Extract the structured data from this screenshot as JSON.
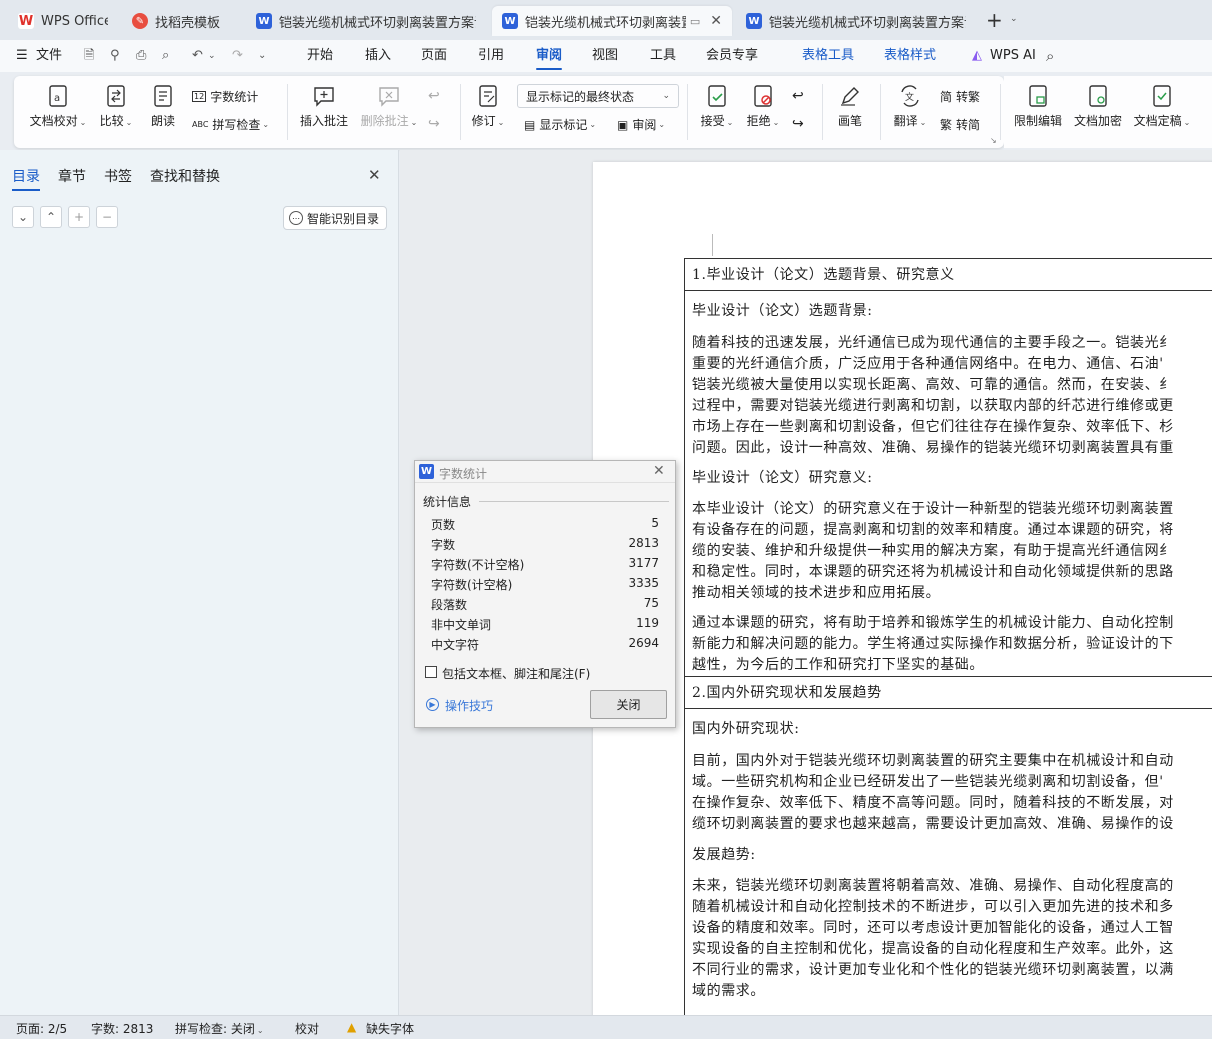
{
  "tabs": [
    {
      "label": "WPS Office",
      "icon": "wps-logo-icon",
      "color": "#e0312b"
    },
    {
      "label": "找稻壳模板",
      "icon": "docer-icon",
      "color": "#e84e40"
    },
    {
      "label": "铠装光缆机械式环切剥离装置方案设计",
      "icon": "word-doc-icon",
      "color": "#2e62d9"
    },
    {
      "label": "铠装光缆机械式环切剥离装置方",
      "icon": "word-doc-icon",
      "color": "#2e62d9"
    },
    {
      "label": "铠装光缆机械式环切剥离装置方案设计",
      "icon": "word-doc-icon",
      "color": "#2e62d9"
    }
  ],
  "menu": {
    "file": "文件",
    "items": [
      "开始",
      "插入",
      "页面",
      "引用",
      "审阅",
      "视图",
      "工具",
      "会员专享"
    ],
    "active": "审阅",
    "table_tools": "表格工具",
    "table_style": "表格样式",
    "wps_ai": "WPS AI"
  },
  "ribbon": {
    "doc_check": "文档校对",
    "compare": "比较",
    "read_aloud": "朗读",
    "word_count": "字数统计",
    "spell_check": "拼写检查",
    "insert_comment": "插入批注",
    "delete_comment": "删除批注",
    "track": "修订",
    "markup_dropdown": "显示标记的最终状态",
    "show_markup": "显示标记",
    "review": "审阅",
    "accept": "接受",
    "reject": "拒绝",
    "pen": "画笔",
    "translate": "翻译",
    "to_traditional": "转繁",
    "to_simplified": "转简",
    "restrict_edit": "限制编辑",
    "encrypt": "文档加密",
    "finalize": "文档定稿"
  },
  "left_panel": {
    "tabs": [
      "目录",
      "章节",
      "书签",
      "查找和替换"
    ],
    "active_tab": "目录",
    "smart_toc": "智能识别目录"
  },
  "document": {
    "h1": "1.毕业设计（论文）选题背景、研究意义",
    "s1_title": "毕业设计（论文）选题背景:",
    "p1": [
      "随着科技的迅速发展，光纤通信已成为现代通信的主要手段之一。铠装光纟",
      "重要的光纤通信介质，广泛应用于各种通信网络中。在电力、通信、石油'",
      "铠装光缆被大量使用以实现长距离、高效、可靠的通信。然而，在安装、纟",
      "过程中，需要对铠装光缆进行剥离和切割，以获取内部的纤芯进行维修或更",
      "市场上存在一些剥离和切割设备，但它们往往存在操作复杂、效率低下、杉",
      "问题。因此，设计一种高效、准确、易操作的铠装光缆环切剥离装置具有重"
    ],
    "s2_title": "毕业设计（论文）研究意义:",
    "p2": [
      "本毕业设计（论文）的研究意义在于设计一种新型的铠装光缆环切剥离装置",
      "有设备存在的问题，提高剥离和切割的效率和精度。通过本课题的研究，将",
      "缆的安装、维护和升级提供一种实用的解决方案，有助于提高光纤通信网纟",
      "和稳定性。同时，本课题的研究还将为机械设计和自动化领域提供新的思路",
      "推动相关领域的技术进步和应用拓展。"
    ],
    "p3": [
      "通过本课题的研究，将有助于培养和锻炼学生的机械设计能力、自动化控制",
      "新能力和解决问题的能力。学生将通过实际操作和数据分析，验证设计的下",
      "越性，为今后的工作和研究打下坚实的基础。"
    ],
    "h2": "2.国内外研究现状和发展趋势",
    "s3_title": "国内外研究现状:",
    "p4": [
      "目前，国内外对于铠装光缆环切剥离装置的研究主要集中在机械设计和自动",
      "域。一些研究机构和企业已经研发出了一些铠装光缆剥离和切割设备，但'",
      "在操作复杂、效率低下、精度不高等问题。同时，随着科技的不断发展，对",
      "缆环切剥离装置的要求也越来越高，需要设计更加高效、准确、易操作的设"
    ],
    "s4_title": "发展趋势:",
    "p5": [
      "未来，铠装光缆环切剥离装置将朝着高效、准确、易操作、自动化程度高的",
      "随着机械设计和自动化控制技术的不断进步，可以引入更加先进的技术和多",
      "设备的精度和效率。同时，还可以考虑设计更加智能化的设备，通过人工智",
      "实现设备的自主控制和优化，提高设备的自动化程度和生产效率。此外，这",
      "不同行业的需求，设计更加专业化和个性化的铠装光缆环切剥离装置，以满",
      "域的需求。"
    ]
  },
  "dialog": {
    "title": "字数统计",
    "section": "统计信息",
    "rows": [
      {
        "label": "页数",
        "value": "5"
      },
      {
        "label": "字数",
        "value": "2813"
      },
      {
        "label": "字符数(不计空格)",
        "value": "3177"
      },
      {
        "label": "字符数(计空格)",
        "value": "3335"
      },
      {
        "label": "段落数",
        "value": "75"
      },
      {
        "label": "非中文单词",
        "value": "119"
      },
      {
        "label": "中文字符",
        "value": "2694"
      }
    ],
    "checkbox_label": "包括文本框、脚注和尾注(F)",
    "tips": "操作技巧",
    "close": "关闭"
  },
  "status": {
    "page": "页面: 2/5",
    "words": "字数: 2813",
    "spell": "拼写检查: 关闭",
    "proof": "校对",
    "missing_font": "缺失字体"
  },
  "colors": {
    "accent": "#1a5cc8",
    "wps_red": "#e0312b",
    "word_blue": "#2e62d9"
  }
}
